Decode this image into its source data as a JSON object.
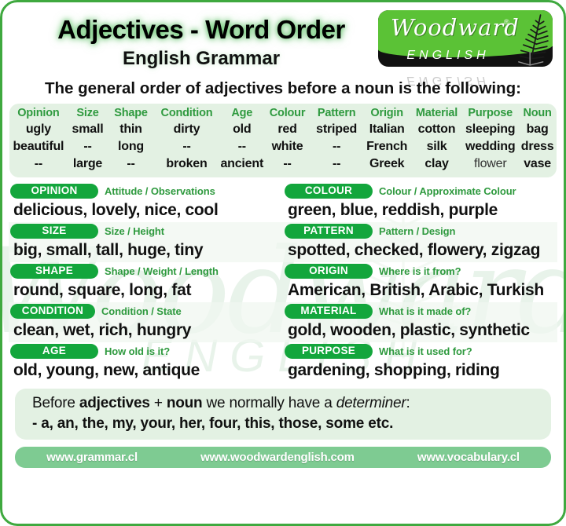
{
  "header": {
    "title": "Adjectives - Word Order",
    "subtitle": "English Grammar",
    "logo": {
      "word": "Woodward",
      "registered": "®",
      "sub": "ENGLISH",
      "reflection": "ENGLISH",
      "fern_icon": "fern-leaf-icon",
      "green": "#5BC236",
      "black": "#111111"
    }
  },
  "intro": "The general order of adjectives before a noun is the following:",
  "table": {
    "headers": [
      "Opinion",
      "Size",
      "Shape",
      "Condition",
      "Age",
      "Colour",
      "Pattern",
      "Origin",
      "Material",
      "Purpose",
      "Noun"
    ],
    "rows": [
      [
        "ugly",
        "small",
        "thin",
        "dirty",
        "old",
        "red",
        "striped",
        "Italian",
        "cotton",
        "sleeping",
        "bag"
      ],
      [
        "beautiful",
        "--",
        "long",
        "--",
        "--",
        "white",
        "--",
        "French",
        "silk",
        "wedding",
        "dress"
      ],
      [
        "--",
        "large",
        "--",
        "broken",
        "ancient",
        "--",
        "--",
        "Greek",
        "clay",
        "flower",
        "vase"
      ]
    ]
  },
  "categories": {
    "left": [
      {
        "pill": "OPINION",
        "hint": "Attitude / Observations",
        "examples": "delicious, lovely, nice, cool"
      },
      {
        "pill": "SIZE",
        "hint": "Size / Height",
        "examples": "big, small, tall, huge, tiny"
      },
      {
        "pill": "SHAPE",
        "hint": "Shape / Weight / Length",
        "examples": "round, square, long, fat"
      },
      {
        "pill": "CONDITION",
        "hint": "Condition / State",
        "examples": "clean, wet, rich, hungry"
      },
      {
        "pill": "AGE",
        "hint": "How old is it?",
        "examples": "old, young, new, antique"
      }
    ],
    "right": [
      {
        "pill": "COLOUR",
        "hint": "Colour / Approximate Colour",
        "examples": "green, blue, reddish, purple"
      },
      {
        "pill": "PATTERN",
        "hint": "Pattern / Design",
        "examples": "spotted, checked, flowery, zigzag"
      },
      {
        "pill": "ORIGIN",
        "hint": "Where is it from?",
        "examples": "American, British, Arabic, Turkish"
      },
      {
        "pill": "MATERIAL",
        "hint": "What is it made of?",
        "examples": "gold, wooden, plastic, synthetic"
      },
      {
        "pill": "PURPOSE",
        "hint": "What is it used for?",
        "examples": "gardening, shopping, riding"
      }
    ]
  },
  "determiner": {
    "line1_a": "Before ",
    "line1_b": "adjectives",
    "line1_c": " + ",
    "line1_d": "noun",
    "line1_e": " we normally have a ",
    "line1_f": "determiner",
    "line1_g": ":",
    "line2": "- a, an, the, my, your, her, four, this, those, some etc."
  },
  "footer": {
    "links": [
      "www.grammar.cl",
      "www.woodwardenglish.com",
      "www.vocabulary.cl"
    ],
    "background": "#7ECB92"
  },
  "watermark": {
    "word": "Woodward",
    "sub": "ENGLISH"
  },
  "colors": {
    "border": "#3FA93F",
    "pill": "#13A63C",
    "accent_text": "#2F9A3F",
    "panel": "#E3F1E3"
  }
}
